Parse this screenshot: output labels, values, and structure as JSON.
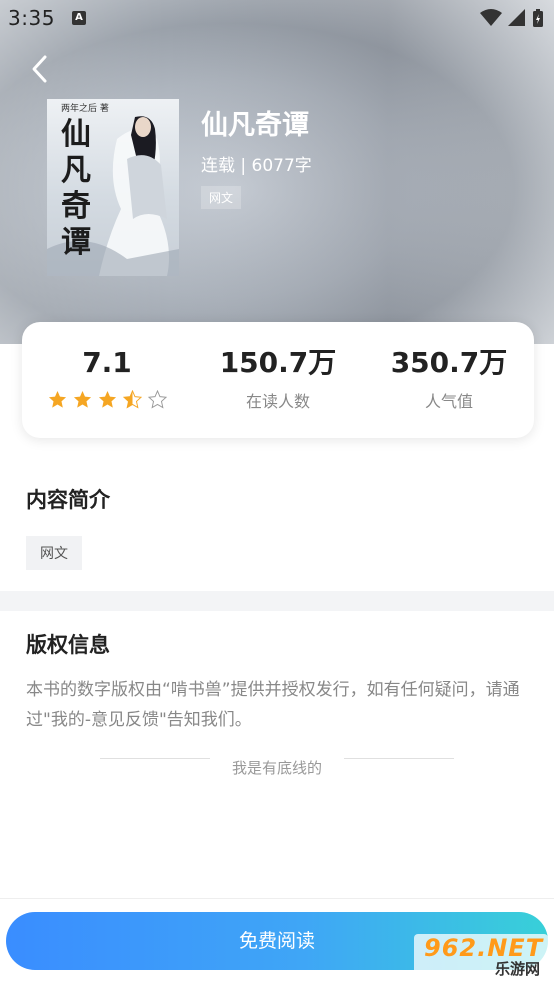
{
  "status_bar": {
    "time": "3:35",
    "a_icon_letter": "A"
  },
  "book": {
    "title": "仙凡奇谭",
    "meta": "连载 | 6077字",
    "tag": "网文",
    "cover_title": "仙凡奇谭",
    "cover_author": "两年之后 著"
  },
  "stats": {
    "rating": "7.1",
    "star_rating": 3.5,
    "readers_value": "150.7万",
    "readers_label": "在读人数",
    "popularity_value": "350.7万",
    "popularity_label": "人气值"
  },
  "intro": {
    "title": "内容简介",
    "tag": "网文"
  },
  "copyright": {
    "title": "版权信息",
    "text": "本书的数字版权由“啃书兽”提供并授权发行，如有任何疑问，请通过\"我的-意见反馈\"告知我们。",
    "bottom_line": "我是有底线的"
  },
  "actions": {
    "read_button": "免费阅读"
  },
  "watermark": {
    "top": "962.NET",
    "bottom": "乐游网"
  },
  "colors": {
    "button_start": "#3a8dff",
    "button_end": "#38d0d8",
    "star": "#f5a623"
  }
}
